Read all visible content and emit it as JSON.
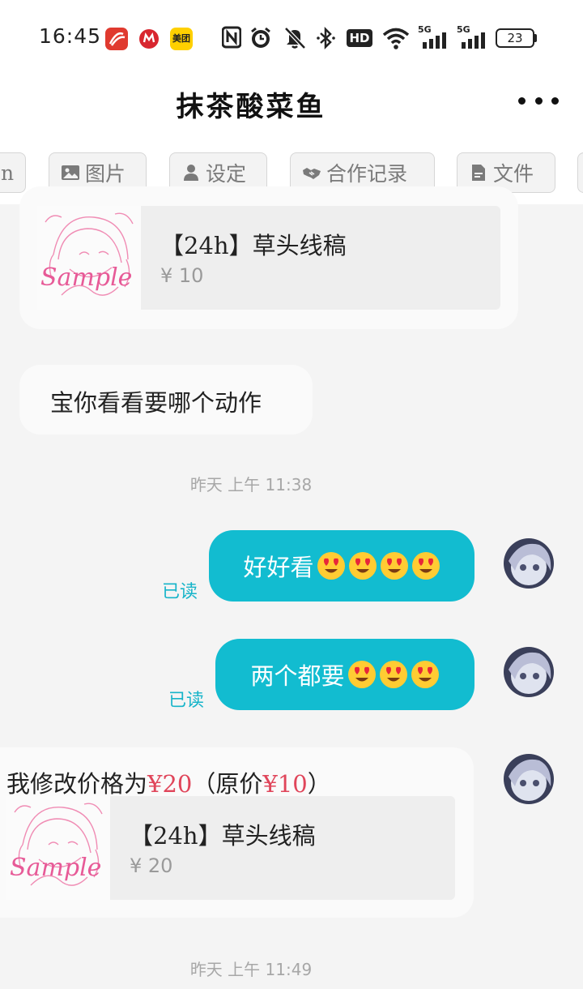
{
  "status_bar": {
    "time": "16:45",
    "app_icons": [
      "xuexi-icon",
      "metro-icon",
      "meituan-icon"
    ],
    "meituan_label": "美团",
    "icons": [
      "nfc-icon",
      "alarm-icon",
      "mute-icon",
      "bluetooth-icon",
      "hd-icon",
      "wifi-icon",
      "signal-5g-icon",
      "signal-5g-icon"
    ],
    "hd_label": "HD",
    "fiveg_label": "5G",
    "battery": "23"
  },
  "header": {
    "title": "抹茶酸菜鱼"
  },
  "tabs": [
    {
      "label": "n",
      "icon": ""
    },
    {
      "label": "图片",
      "icon": "image-icon"
    },
    {
      "label": "设定",
      "icon": "person-icon"
    },
    {
      "label": "合作记录",
      "icon": "handshake-icon"
    },
    {
      "label": "文件",
      "icon": "file-icon"
    }
  ],
  "messages": {
    "product1": {
      "title": "【24h】草头线稿",
      "price": "¥ 10"
    },
    "text1": "宝你看看要哪个动作",
    "time1": "昨天 上午 11:38",
    "sent1": {
      "text": "好好看",
      "read": "已读"
    },
    "sent2": {
      "text": "两个都要",
      "read": "已读"
    },
    "price_change": {
      "prefix": "我修改价格为",
      "new_price": "¥20",
      "paren_open": "（原价",
      "old_price": "¥10",
      "paren_close": "）"
    },
    "product2": {
      "title": "【24h】草头线稿",
      "price": "¥ 20"
    },
    "time2": "昨天 上午 11:49"
  },
  "colors": {
    "accent": "#12bcd0",
    "read_text": "#16b4c9",
    "price_red": "#e0455a",
    "background": "#f4f4f4"
  }
}
